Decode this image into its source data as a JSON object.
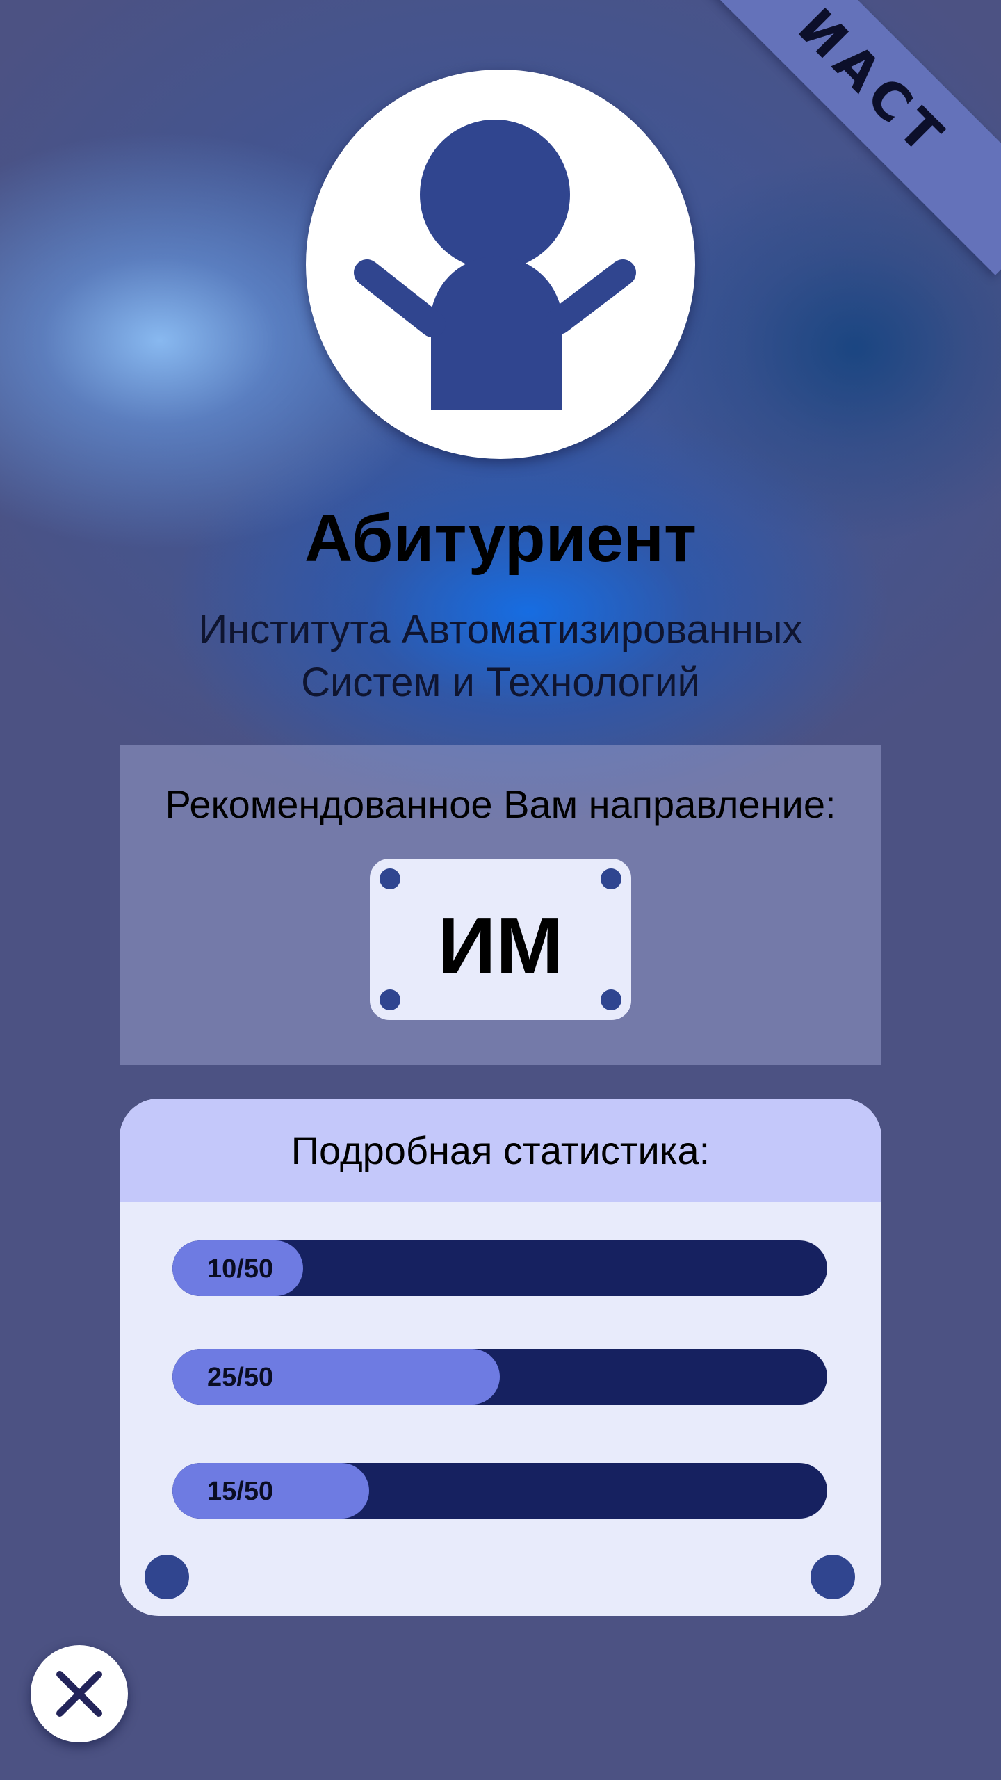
{
  "ribbon": {
    "label": "ИАСТ"
  },
  "profile": {
    "avatar_icon": "person-icon",
    "title": "Абитуриент",
    "subtitle_line1": "Института Автоматизированных",
    "subtitle_line2": "Систем и Технологий"
  },
  "recommendation": {
    "label": "Рекомендованное Вам направление:",
    "code": "ИМ"
  },
  "stats": {
    "title": "Подробная статистика:",
    "items": [
      {
        "label": "10/50",
        "value": 10,
        "max": 50
      },
      {
        "label": "25/50",
        "value": 25,
        "max": 50
      },
      {
        "label": "15/50",
        "value": 15,
        "max": 50
      }
    ]
  },
  "close": {
    "icon": "close-icon"
  },
  "colors": {
    "background": "#4c5283",
    "ribbon": "#6472ba",
    "accent_dark": "#2f4590",
    "bar_track": "#162160",
    "bar_fill": "#6e7be2",
    "panel_light": "#e8ebfb",
    "panel_header": "#c4c8fa"
  }
}
